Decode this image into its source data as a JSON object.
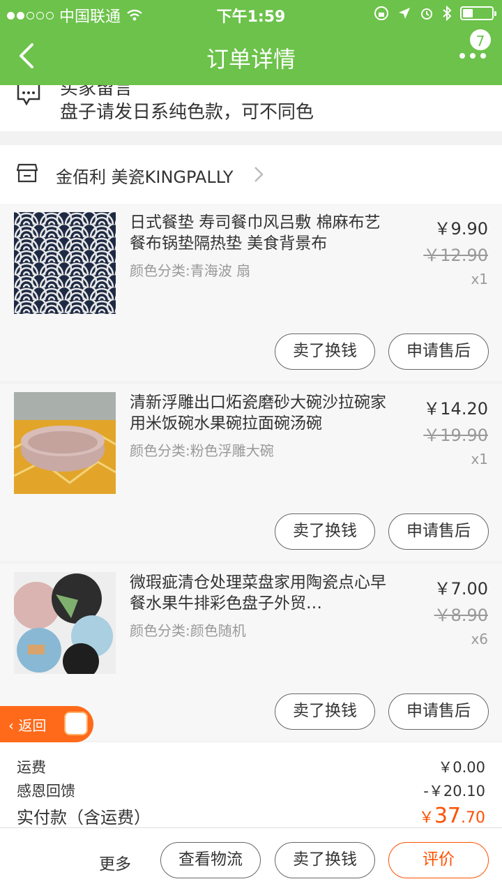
{
  "status": {
    "carrier": "中国联通",
    "time": "下午1:59"
  },
  "nav": {
    "title": "订单详情",
    "badge": "7"
  },
  "message": {
    "label": "买家留言",
    "text": "盘子请发日系纯色款，可不同色"
  },
  "shop": {
    "name": "金佰利 美瓷KINGPALLY"
  },
  "items": [
    {
      "title": "日式餐垫 寿司餐巾风吕敷 棉麻布艺餐布锅垫隔热垫 美食背景布",
      "spec": "颜色分类:青海波 扇",
      "price": "￥9.90",
      "original_price": "￥12.90",
      "qty": "x1",
      "sell_label": "卖了换钱",
      "after_label": "申请售后"
    },
    {
      "title": "清新浮雕出口炻瓷磨砂大碗沙拉碗家用米饭碗水果碗拉面碗汤碗",
      "spec": "颜色分类:粉色浮雕大碗",
      "price": "￥14.20",
      "original_price": "￥19.90",
      "qty": "x1",
      "sell_label": "卖了换钱",
      "after_label": "申请售后"
    },
    {
      "title": "微瑕疵清仓处理菜盘家用陶瓷点心早餐水果牛排彩色盘子外贸…",
      "spec": "颜色分类:颜色随机",
      "price": "￥7.00",
      "original_price": "￥8.90",
      "qty": "x6",
      "sell_label": "卖了换钱",
      "after_label": "申请售后"
    }
  ],
  "float_back": {
    "label": "返回"
  },
  "summary": {
    "shipping_label": "运费",
    "shipping_value": "￥0.00",
    "rebate_label": "感恩回馈",
    "rebate_value": "-￥20.10",
    "paid_label": "实付款（含运费）",
    "paid_currency": "￥",
    "paid_int": "37",
    "paid_dec": ".70"
  },
  "bottom": {
    "more": "更多",
    "logistics": "查看物流",
    "sell": "卖了换钱",
    "review": "评价"
  },
  "colors": {
    "brand_green": "#6cc24a",
    "accent_orange": "#ff5000"
  }
}
